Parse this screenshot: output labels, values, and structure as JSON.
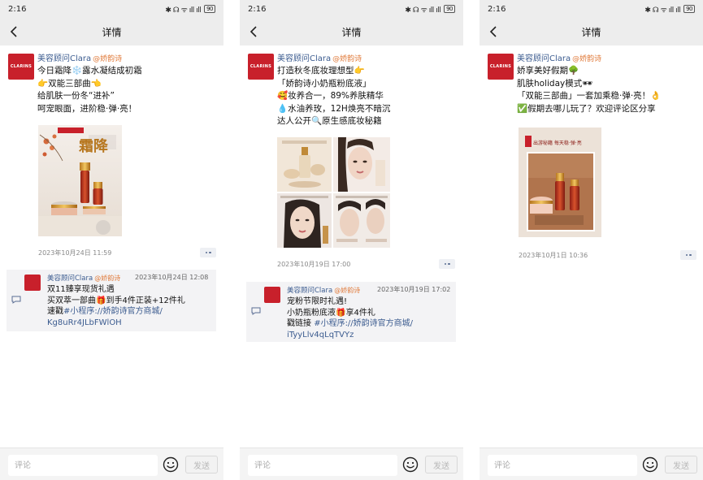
{
  "status": {
    "time": "2:16",
    "signal": "✱ ☊ ᯤ ıll ıll",
    "battery": "90"
  },
  "nav": {
    "title": "详情"
  },
  "common": {
    "author": "美容顾问Clara",
    "tag": "@娇韵诗",
    "brand": "CLARINS",
    "comment_placeholder": "评论",
    "send_label": "发送"
  },
  "posts": [
    {
      "lines": [
        "今日霜降❄️露水凝结成初霜",
        "👉双能三部曲👈",
        "给肌肤一份冬“进补”",
        "呵宠眼面，进阶稳·弹·亮！"
      ],
      "image_caption": "霜降",
      "timestamp": "2023年10月24日 11:59",
      "comment": {
        "time": "2023年10月24日 12:08",
        "lines": [
          "双11臻享现货礼遇",
          "买双萃一部曲🎁到手4件正装+12件礼",
          "速戳",
          "#小程序://娇韵诗官方商城/",
          "Kg8uRr4JLbFWlOH"
        ]
      }
    },
    {
      "lines": [
        "打造秋冬底妆理想型👉",
        "「娇韵诗小奶瓶粉底液」",
        "🥰妆养合一，89%养肤精华",
        "💧水油养玫，12H焕亮不暗沉",
        "达人公开🔍原生感底妆秘籍"
      ],
      "timestamp": "2023年10月19日 17:00",
      "comment": {
        "time": "2023年10月19日 17:02",
        "lines": [
          "宠粉节限时礼遇!",
          "小奶瓶粉底液🎁享4件礼",
          "戳链接",
          "#小程序://娇韵诗官方商城/",
          "iTyyLlv4qLqTVYz"
        ]
      }
    },
    {
      "lines": [
        "娇享美好假期🌳",
        "肌肤holiday模式🕶",
        "「双能三部曲」一套加乘稳·弹·亮！👌",
        "✅假期去哪儿玩了？欢迎评论区分享"
      ],
      "image_caption": "出游秘籍 每天稳·弹·亮",
      "timestamp": "2023年10月1日 10:36"
    }
  ],
  "colors": {
    "brand_red": "#c8202b",
    "link_blue": "#3b5b8f",
    "tag_orange": "#e07a3a"
  },
  "icons": {
    "back": "chevron-left-icon",
    "comment": "comment-bubble-icon",
    "emoji": "smiley-face-icon",
    "more": "more-dots-icon"
  }
}
